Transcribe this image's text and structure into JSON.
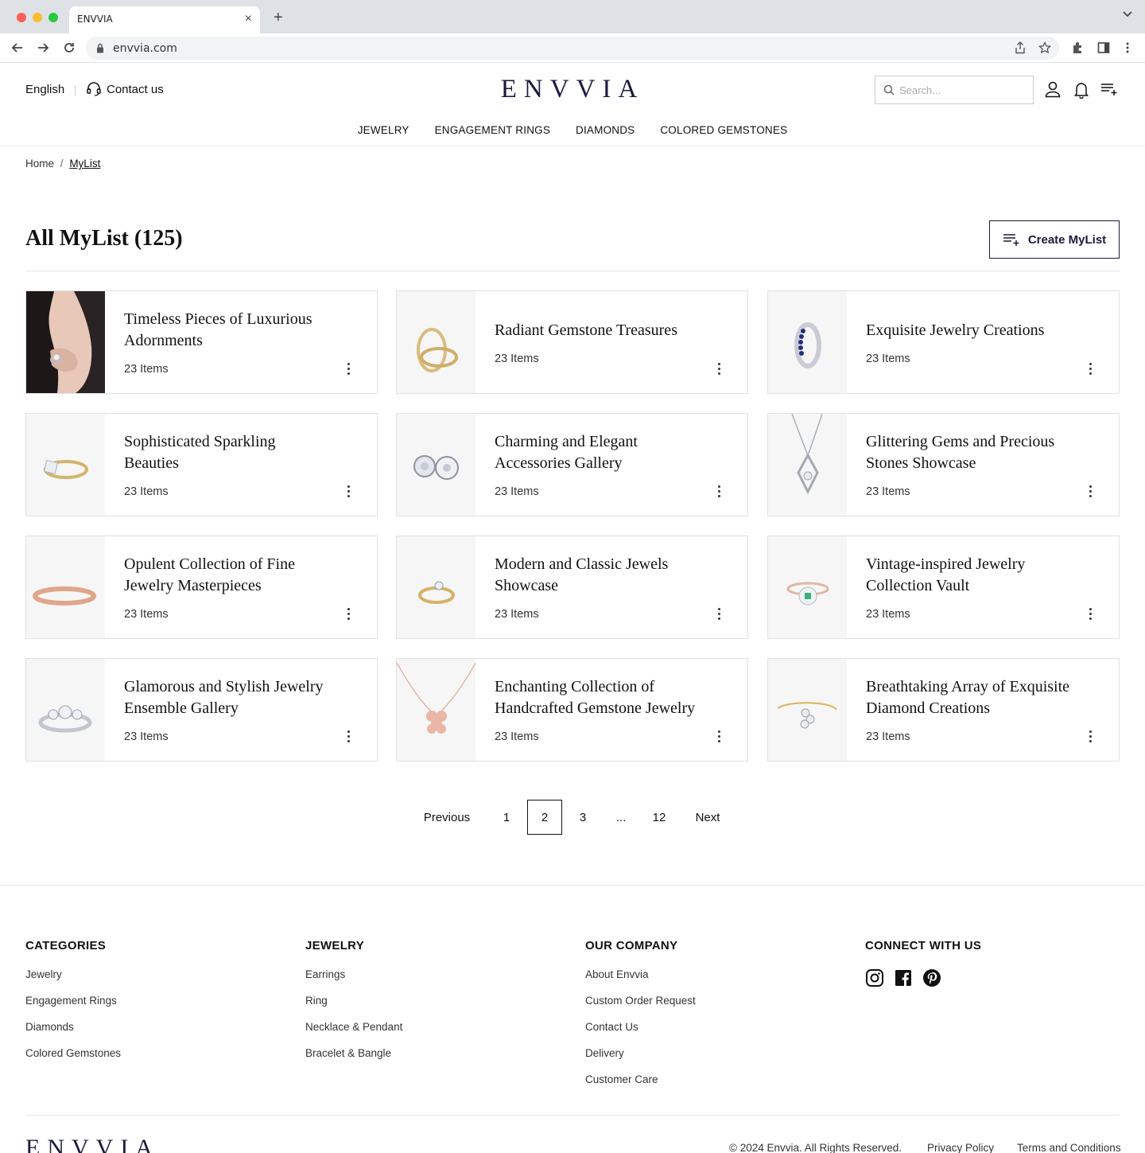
{
  "browser": {
    "tab_title": "ENVVIA",
    "url": "envvia.com"
  },
  "header": {
    "language": "English",
    "contact_label": "Contact us",
    "logo": "ENVVIA",
    "search_placeholder": "Search..."
  },
  "nav": {
    "items": [
      "JEWELRY",
      "ENGAGEMENT RINGS",
      "DIAMONDS",
      "COLORED GEMSTONES"
    ]
  },
  "breadcrumb": {
    "home": "Home",
    "separator": "/",
    "current": "MyList"
  },
  "page": {
    "title": "All MyList (125)",
    "create_button": "Create MyList"
  },
  "lists": [
    {
      "title": "Timeless Pieces of Luxurious Adornments",
      "count": "23 Items",
      "image": "model-wearing-ring"
    },
    {
      "title": "Radiant Gemstone Treasures",
      "count": "23 Items",
      "image": "gold-bands"
    },
    {
      "title": "Exquisite Jewelry Creations",
      "count": "23 Items",
      "image": "sapphire-ring"
    },
    {
      "title": "Sophisticated Sparkling Beauties",
      "count": "23 Items",
      "image": "princess-cut-ring"
    },
    {
      "title": "Charming and Elegant Accessories Gallery",
      "count": "23 Items",
      "image": "diamond-studs"
    },
    {
      "title": "Glittering Gems and Precious Stones Showcase",
      "count": "23 Items",
      "image": "diamond-pendant"
    },
    {
      "title": "Opulent Collection of Fine Jewelry Masterpieces",
      "count": "23 Items",
      "image": "rose-gold-band"
    },
    {
      "title": "Modern and Classic Jewels Showcase",
      "count": "23 Items",
      "image": "solitaire-ring"
    },
    {
      "title": "Vintage-inspired Jewelry Collection Vault",
      "count": "23 Items",
      "image": "emerald-halo-ring"
    },
    {
      "title": "Glamorous and Stylish Jewelry Ensemble Gallery",
      "count": "23 Items",
      "image": "three-stone-ring"
    },
    {
      "title": "Enchanting Collection of Handcrafted Gemstone Jewelry",
      "count": "23 Items",
      "image": "flower-necklace"
    },
    {
      "title": "Breathtaking Array of Exquisite Diamond Creations",
      "count": "23 Items",
      "image": "flower-bangle"
    }
  ],
  "pagination": {
    "previous": "Previous",
    "pages": [
      "1",
      "2",
      "3",
      "...",
      "12"
    ],
    "current": "2",
    "next": "Next"
  },
  "footer": {
    "columns": [
      {
        "heading": "CATEGORIES",
        "links": [
          "Jewelry",
          "Engagement Rings",
          "Diamonds",
          "Colored Gemstones"
        ]
      },
      {
        "heading": "JEWELRY",
        "links": [
          "Earrings",
          "Ring",
          "Necklace & Pendant",
          "Bracelet & Bangle"
        ]
      },
      {
        "heading": "OUR COMPANY",
        "links": [
          "About Envvia",
          "Custom Order Request",
          "Contact Us",
          "Delivery",
          "Customer Care"
        ]
      },
      {
        "heading": "CONNECT WITH US",
        "links": []
      }
    ],
    "social": [
      "instagram-icon",
      "facebook-icon",
      "pinterest-icon"
    ],
    "logo": "ENVVIA",
    "copyright": "© 2024 Envvia. All Rights Reserved.",
    "privacy": "Privacy Policy",
    "terms": "Terms and Conditions"
  },
  "colors": {
    "brand": "#1b1a3e",
    "border": "#e1e1e1",
    "thumb_bg": "#f6f6f7"
  }
}
